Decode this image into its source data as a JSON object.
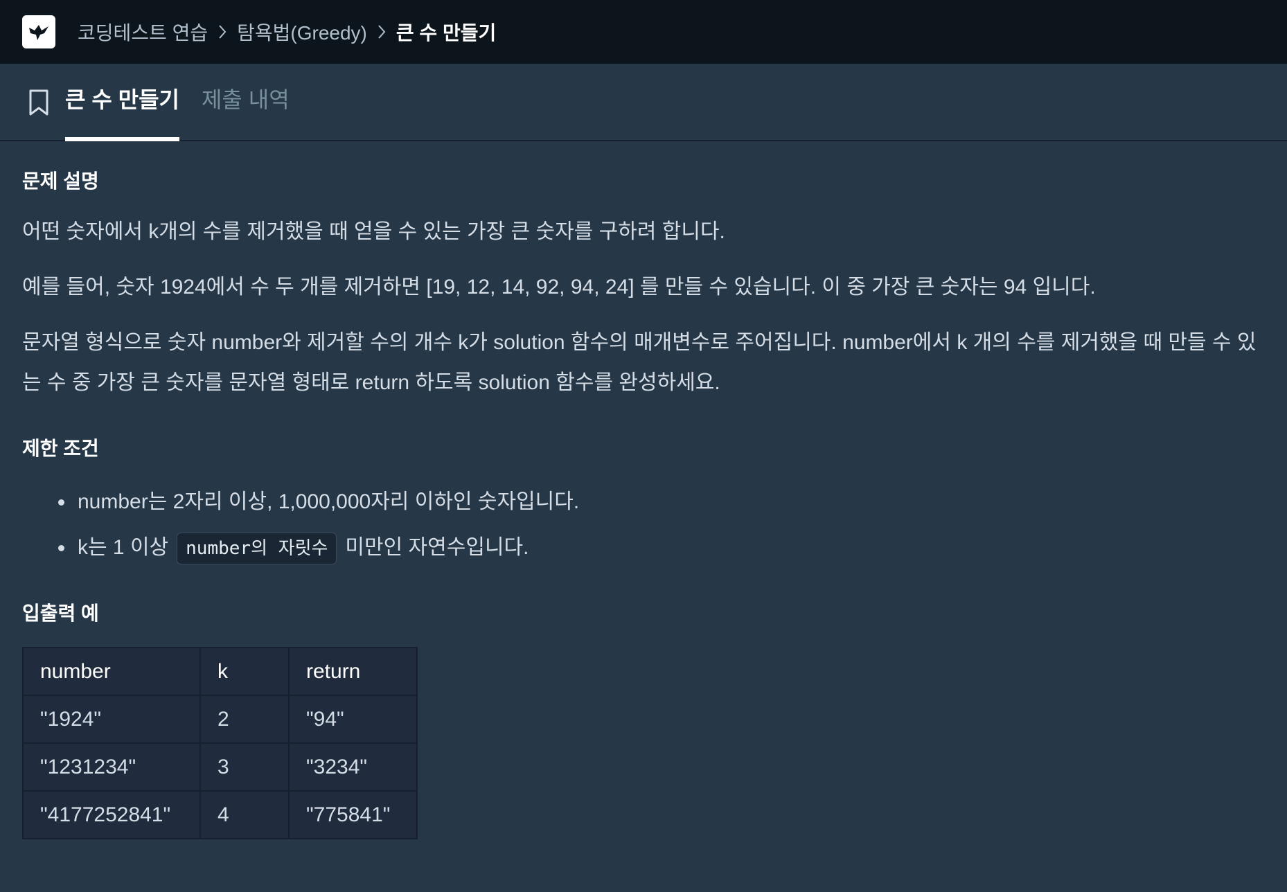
{
  "breadcrumb": {
    "items": [
      "코딩테스트 연습",
      "탐욕법(Greedy)"
    ],
    "current": "큰 수 만들기"
  },
  "tabs": {
    "active": "큰 수 만들기",
    "inactive": "제출 내역"
  },
  "problem": {
    "description_title": "문제 설명",
    "paragraphs": [
      "어떤 숫자에서 k개의 수를 제거했을 때 얻을 수 있는 가장 큰 숫자를 구하려 합니다.",
      "예를 들어, 숫자 1924에서 수 두 개를 제거하면 [19, 12, 14, 92, 94, 24] 를 만들 수 있습니다. 이 중 가장 큰 숫자는 94 입니다.",
      "문자열 형식으로 숫자 number와 제거할 수의 개수 k가 solution 함수의 매개변수로 주어집니다. number에서 k 개의 수를 제거했을 때 만들 수 있는 수 중 가장 큰 숫자를 문자열 형태로 return 하도록 solution 함수를 완성하세요."
    ],
    "constraints_title": "제한 조건",
    "constraints": {
      "c1": "number는 2자리 이상, 1,000,000자리 이하인 숫자입니다.",
      "c2_before": "k는 1 이상",
      "c2_code": "number의 자릿수",
      "c2_after": "미만인 자연수입니다."
    },
    "examples_title": "입출력 예",
    "table": {
      "headers": [
        "number",
        "k",
        "return"
      ],
      "rows": [
        [
          "\"1924\"",
          "2",
          "\"94\""
        ],
        [
          "\"1231234\"",
          "3",
          "\"3234\""
        ],
        [
          "\"4177252841\"",
          "4",
          "\"775841\""
        ]
      ]
    }
  },
  "icons": {
    "logo": "programmers-bird-logo",
    "separator": "chevron-right-icon",
    "bookmark": "bookmark-icon"
  },
  "colors": {
    "topbar_bg": "#0c151c",
    "page_bg": "#263747",
    "table_bg": "#202b3d",
    "text": "#d5dde6"
  }
}
